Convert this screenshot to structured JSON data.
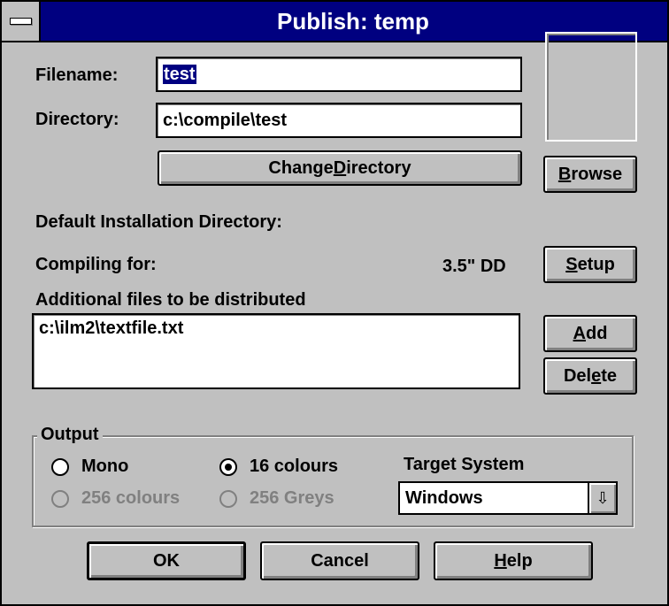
{
  "window": {
    "title": "Publish: temp"
  },
  "labels": {
    "filename": "Filename:",
    "directory": "Directory:",
    "default_install_dir": "Default Installation Directory:",
    "compiling_for": "Compiling for:",
    "compiling_value": "3.5\" DD",
    "additional_files": "Additional files to be distributed",
    "output_group": "Output",
    "target_system": "Target System"
  },
  "fields": {
    "filename_value": "test",
    "directory_value": "c:\\compile\\test"
  },
  "buttons": {
    "change_directory": {
      "pre": "Change ",
      "accel": "D",
      "post": "irectory"
    },
    "browse": {
      "pre": "",
      "accel": "B",
      "post": "rowse"
    },
    "setup": {
      "pre": "",
      "accel": "S",
      "post": "etup"
    },
    "add": {
      "pre": "",
      "accel": "A",
      "post": "dd"
    },
    "delete": {
      "pre": "Del",
      "accel": "e",
      "post": "te"
    },
    "ok": "OK",
    "cancel": "Cancel",
    "help": {
      "pre": "",
      "accel": "H",
      "post": "elp"
    }
  },
  "files_list": [
    "c:\\ilm2\\textfile.txt"
  ],
  "output": {
    "mono": "Mono",
    "colours16": "16 colours",
    "colours256": "256 colours",
    "greys256": "256 Greys",
    "selected": "16 colours"
  },
  "target_system": {
    "selected": "Windows"
  },
  "colors": {
    "titlebar": "#000080",
    "face": "#c0c0c0",
    "disabled": "#808080"
  }
}
